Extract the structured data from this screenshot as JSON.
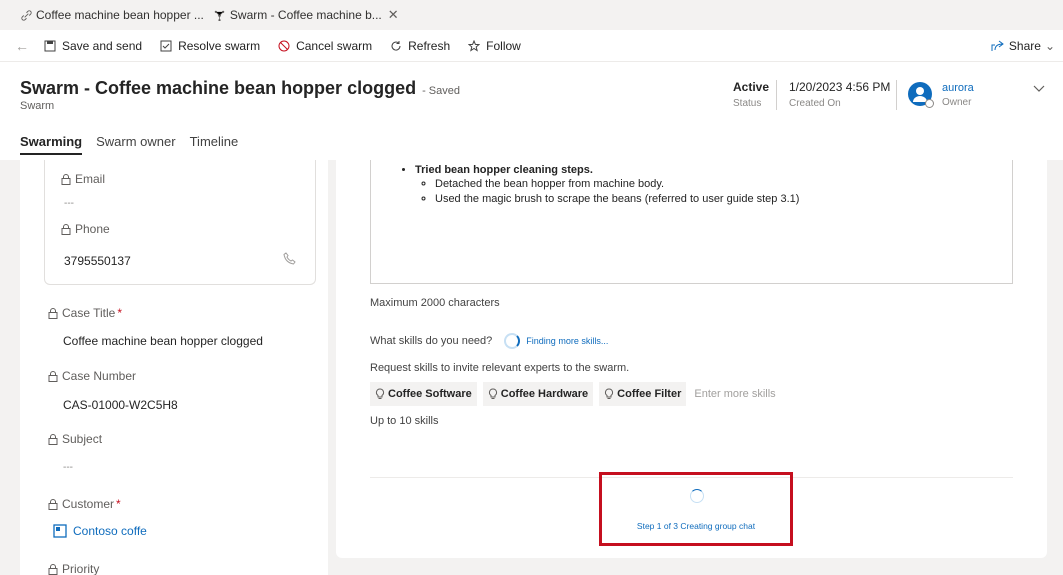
{
  "tabs": [
    {
      "label": "Coffee machine bean hopper ...",
      "icon": "link-icon"
    },
    {
      "label": "Swarm - Coffee machine b...",
      "icon": "swarm-icon"
    }
  ],
  "commands": {
    "save_and_send": "Save and send",
    "resolve_swarm": "Resolve swarm",
    "cancel_swarm": "Cancel swarm",
    "refresh": "Refresh",
    "follow": "Follow",
    "share": "Share"
  },
  "header": {
    "title": "Swarm - Coffee machine bean hopper clogged",
    "saved_status": "- Saved",
    "entity": "Swarm",
    "status_value": "Active",
    "status_label": "Status",
    "created_value": "1/20/2023 4:56 PM",
    "created_label": "Created On",
    "owner_value": "aurora",
    "owner_label": "Owner"
  },
  "nav_tabs": [
    "Swarming",
    "Swarm owner",
    "Timeline"
  ],
  "contact": {
    "email_label": "Email",
    "email_value": "---",
    "phone_label": "Phone",
    "phone_value": "3795550137"
  },
  "fields": {
    "case_title_label": "Case Title",
    "case_title_value": "Coffee machine bean hopper clogged",
    "case_number_label": "Case Number",
    "case_number_value": "CAS-01000-W2C5H8",
    "subject_label": "Subject",
    "subject_value": "---",
    "customer_label": "Customer",
    "customer_value": "Contoso coffe",
    "priority_label": "Priority",
    "required_mark": "*"
  },
  "notes": {
    "bullet": "Tried bean hopper cleaning steps.",
    "sub1": "Detached the bean hopper from machine body.",
    "sub2": "Used the magic brush to scrape the beans (referred to user guide step 3.1)"
  },
  "skills": {
    "max_chars": "Maximum 2000 characters",
    "question": "What skills do you need?",
    "finding": "Finding more skills...",
    "request": "Request skills to invite relevant experts to the swarm.",
    "chips": [
      "Coffee Software",
      "Coffee Hardware",
      "Coffee Filter"
    ],
    "placeholder": "Enter more skills",
    "limit": "Up to 10 skills"
  },
  "progress": {
    "step_text": "Step 1 of 3 Creating group chat"
  },
  "colors": {
    "accent": "#0f6cbd",
    "highlight_border": "#c50f1f"
  }
}
